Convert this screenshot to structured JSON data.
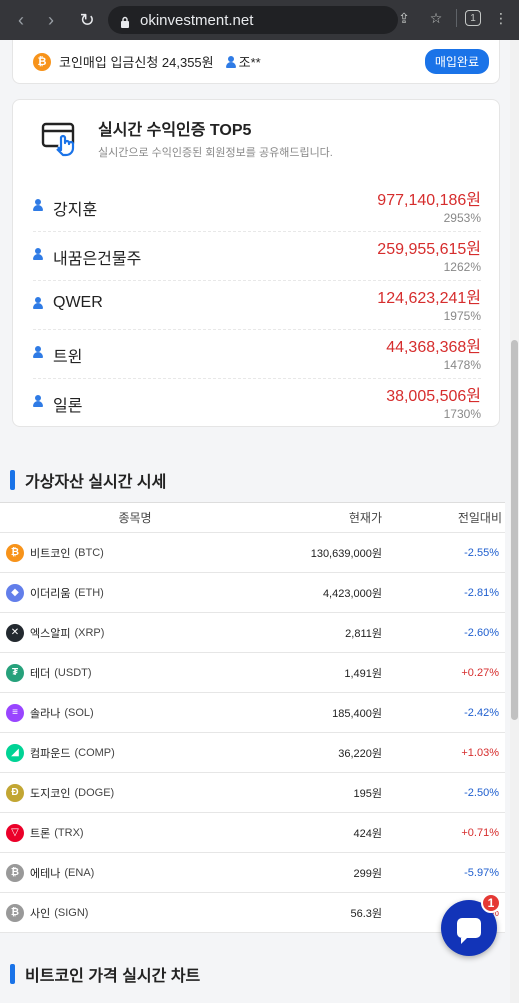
{
  "browser": {
    "url": "okinvestment.net",
    "tab_count": "1"
  },
  "notice": {
    "text": "코인매입 입금신청 24,355원",
    "user": "조**",
    "button": "매입완료"
  },
  "top5": {
    "title": "실시간 수익인증 TOP5",
    "subtitle": "실시간으로 수익인증된 회원정보를 공유해드립니다.",
    "rows": [
      {
        "name": "강지훈",
        "amount": "977,140,186원",
        "pct": "2953%"
      },
      {
        "name": "내꿈은건물주",
        "amount": "259,955,615원",
        "pct": "1262%"
      },
      {
        "name": "QWER",
        "amount": "124,623,241원",
        "pct": "1975%"
      },
      {
        "name": "트윈",
        "amount": "44,368,368원",
        "pct": "1478%"
      },
      {
        "name": "일론",
        "amount": "38,005,506원",
        "pct": "1730%"
      }
    ]
  },
  "prices": {
    "title": "가상자산 실시간 시세",
    "headers": {
      "name": "종목명",
      "price": "현재가",
      "change": "전일대비"
    },
    "rows": [
      {
        "name": "비트코인",
        "symbol": "(BTC)",
        "price": "130,639,000원",
        "change": "-2.55%",
        "dir": "down",
        "color": "#f7931a",
        "glyph": "₿"
      },
      {
        "name": "이더리움",
        "symbol": "(ETH)",
        "price": "4,423,000원",
        "change": "-2.81%",
        "dir": "down",
        "color": "#627eea",
        "glyph": "◆"
      },
      {
        "name": "엑스알피",
        "symbol": "(XRP)",
        "price": "2,811원",
        "change": "-2.60%",
        "dir": "down",
        "color": "#23292f",
        "glyph": "✕"
      },
      {
        "name": "테더",
        "symbol": "(USDT)",
        "price": "1,491원",
        "change": "+0.27%",
        "dir": "up",
        "color": "#26a17b",
        "glyph": "₮"
      },
      {
        "name": "솔라나",
        "symbol": "(SOL)",
        "price": "185,400원",
        "change": "-2.42%",
        "dir": "down",
        "color": "#9945ff",
        "glyph": "≡"
      },
      {
        "name": "컴파운드",
        "symbol": "(COMP)",
        "price": "36,220원",
        "change": "+1.03%",
        "dir": "up",
        "color": "#00d395",
        "glyph": "◢"
      },
      {
        "name": "도지코인",
        "symbol": "(DOGE)",
        "price": "195원",
        "change": "-2.50%",
        "dir": "down",
        "color": "#c2a633",
        "glyph": "Ð"
      },
      {
        "name": "트론",
        "symbol": "(TRX)",
        "price": "424원",
        "change": "+0.71%",
        "dir": "up",
        "color": "#eb0029",
        "glyph": "▽"
      },
      {
        "name": "에테나",
        "symbol": "(ENA)",
        "price": "299원",
        "change": "-5.97%",
        "dir": "down",
        "color": "#999999",
        "glyph": "₿"
      },
      {
        "name": "사인",
        "symbol": "(SIGN)",
        "price": "56.3원",
        "change": "+3.17%",
        "dir": "up",
        "color": "#999999",
        "glyph": "₿"
      }
    ]
  },
  "chart_section": {
    "title": "비트코인 가격 실시간 차트"
  },
  "chat": {
    "badge": "1"
  }
}
